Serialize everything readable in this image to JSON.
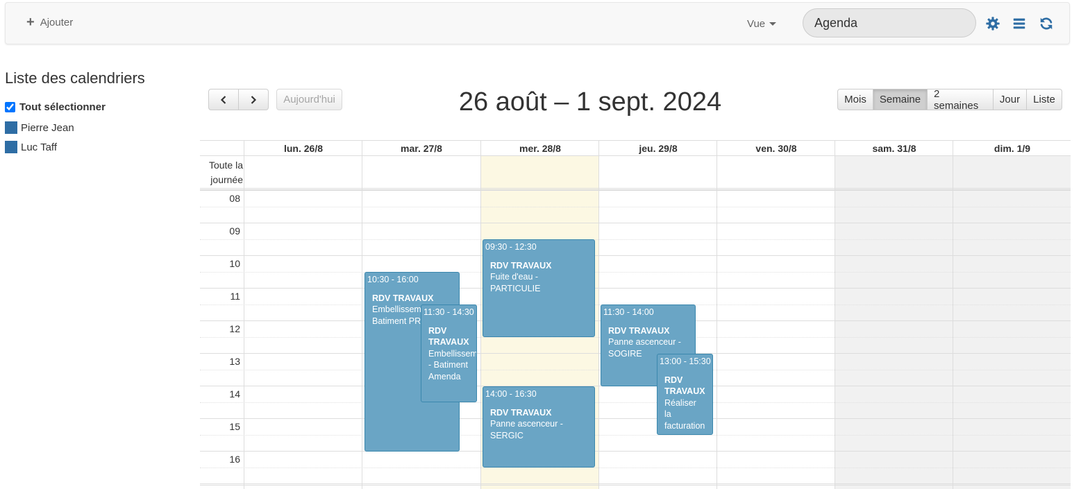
{
  "toolbar": {
    "add_label": "Ajouter",
    "view_label": "Vue",
    "search_value": "Agenda",
    "icons": [
      "gear-icon",
      "list-icon",
      "refresh-icon"
    ],
    "accent": "#2e6da4"
  },
  "sidebar": {
    "title": "Liste des calendriers",
    "select_all": "Tout sélectionner",
    "calendars": [
      {
        "name": "Pierre Jean",
        "color": "#2e6da4"
      },
      {
        "name": "Luc Taff",
        "color": "#2e6da4"
      }
    ]
  },
  "nav": {
    "prev_icon": "chevron-left-icon",
    "next_icon": "chevron-right-icon",
    "today_label": "Aujourd'hui",
    "title": "26 août – 1 sept. 2024",
    "views": [
      "Mois",
      "Semaine",
      "2 semaines",
      "Jour",
      "Liste"
    ],
    "active_view": "Semaine"
  },
  "calendar": {
    "allday_label_1": "Toute la",
    "allday_label_2": "journée",
    "days": [
      "lun. 26/8",
      "mar. 27/8",
      "mer. 28/8",
      "jeu. 29/8",
      "ven. 30/8",
      "sam. 31/8",
      "dim. 1/9"
    ],
    "hours": [
      "08",
      "09",
      "10",
      "11",
      "12",
      "13",
      "14",
      "15",
      "16"
    ],
    "today_color": "#fcf8e3",
    "weekend_color": "#f1f1f1",
    "event_color": "#6aa5c5",
    "events": [
      {
        "day": "mar. 27/8",
        "time": "10:30 - 16:00",
        "title": "RDV TRAVAUX",
        "desc": "Embellissement - Batiment PR"
      },
      {
        "day": "mar. 27/8",
        "time": "11:30 - 14:30",
        "title": "RDV TRAVAUX",
        "desc": "Embellissement - Batiment Amenda"
      },
      {
        "day": "mer. 28/8",
        "time": "09:30 - 12:30",
        "title": "RDV TRAVAUX",
        "desc": "Fuite d'eau - PARTICULIE"
      },
      {
        "day": "mer. 28/8",
        "time": "14:00 - 16:30",
        "title": "RDV TRAVAUX",
        "desc": "Panne ascenceur - SERGIC"
      },
      {
        "day": "jeu. 29/8",
        "time": "11:30 - 14:00",
        "title": "RDV TRAVAUX",
        "desc": "Panne ascenceur - SOGIRE"
      },
      {
        "day": "jeu. 29/8",
        "time": "13:00 - 15:30",
        "title": "RDV TRAVAUX",
        "desc": "Réaliser la facturation"
      }
    ]
  }
}
